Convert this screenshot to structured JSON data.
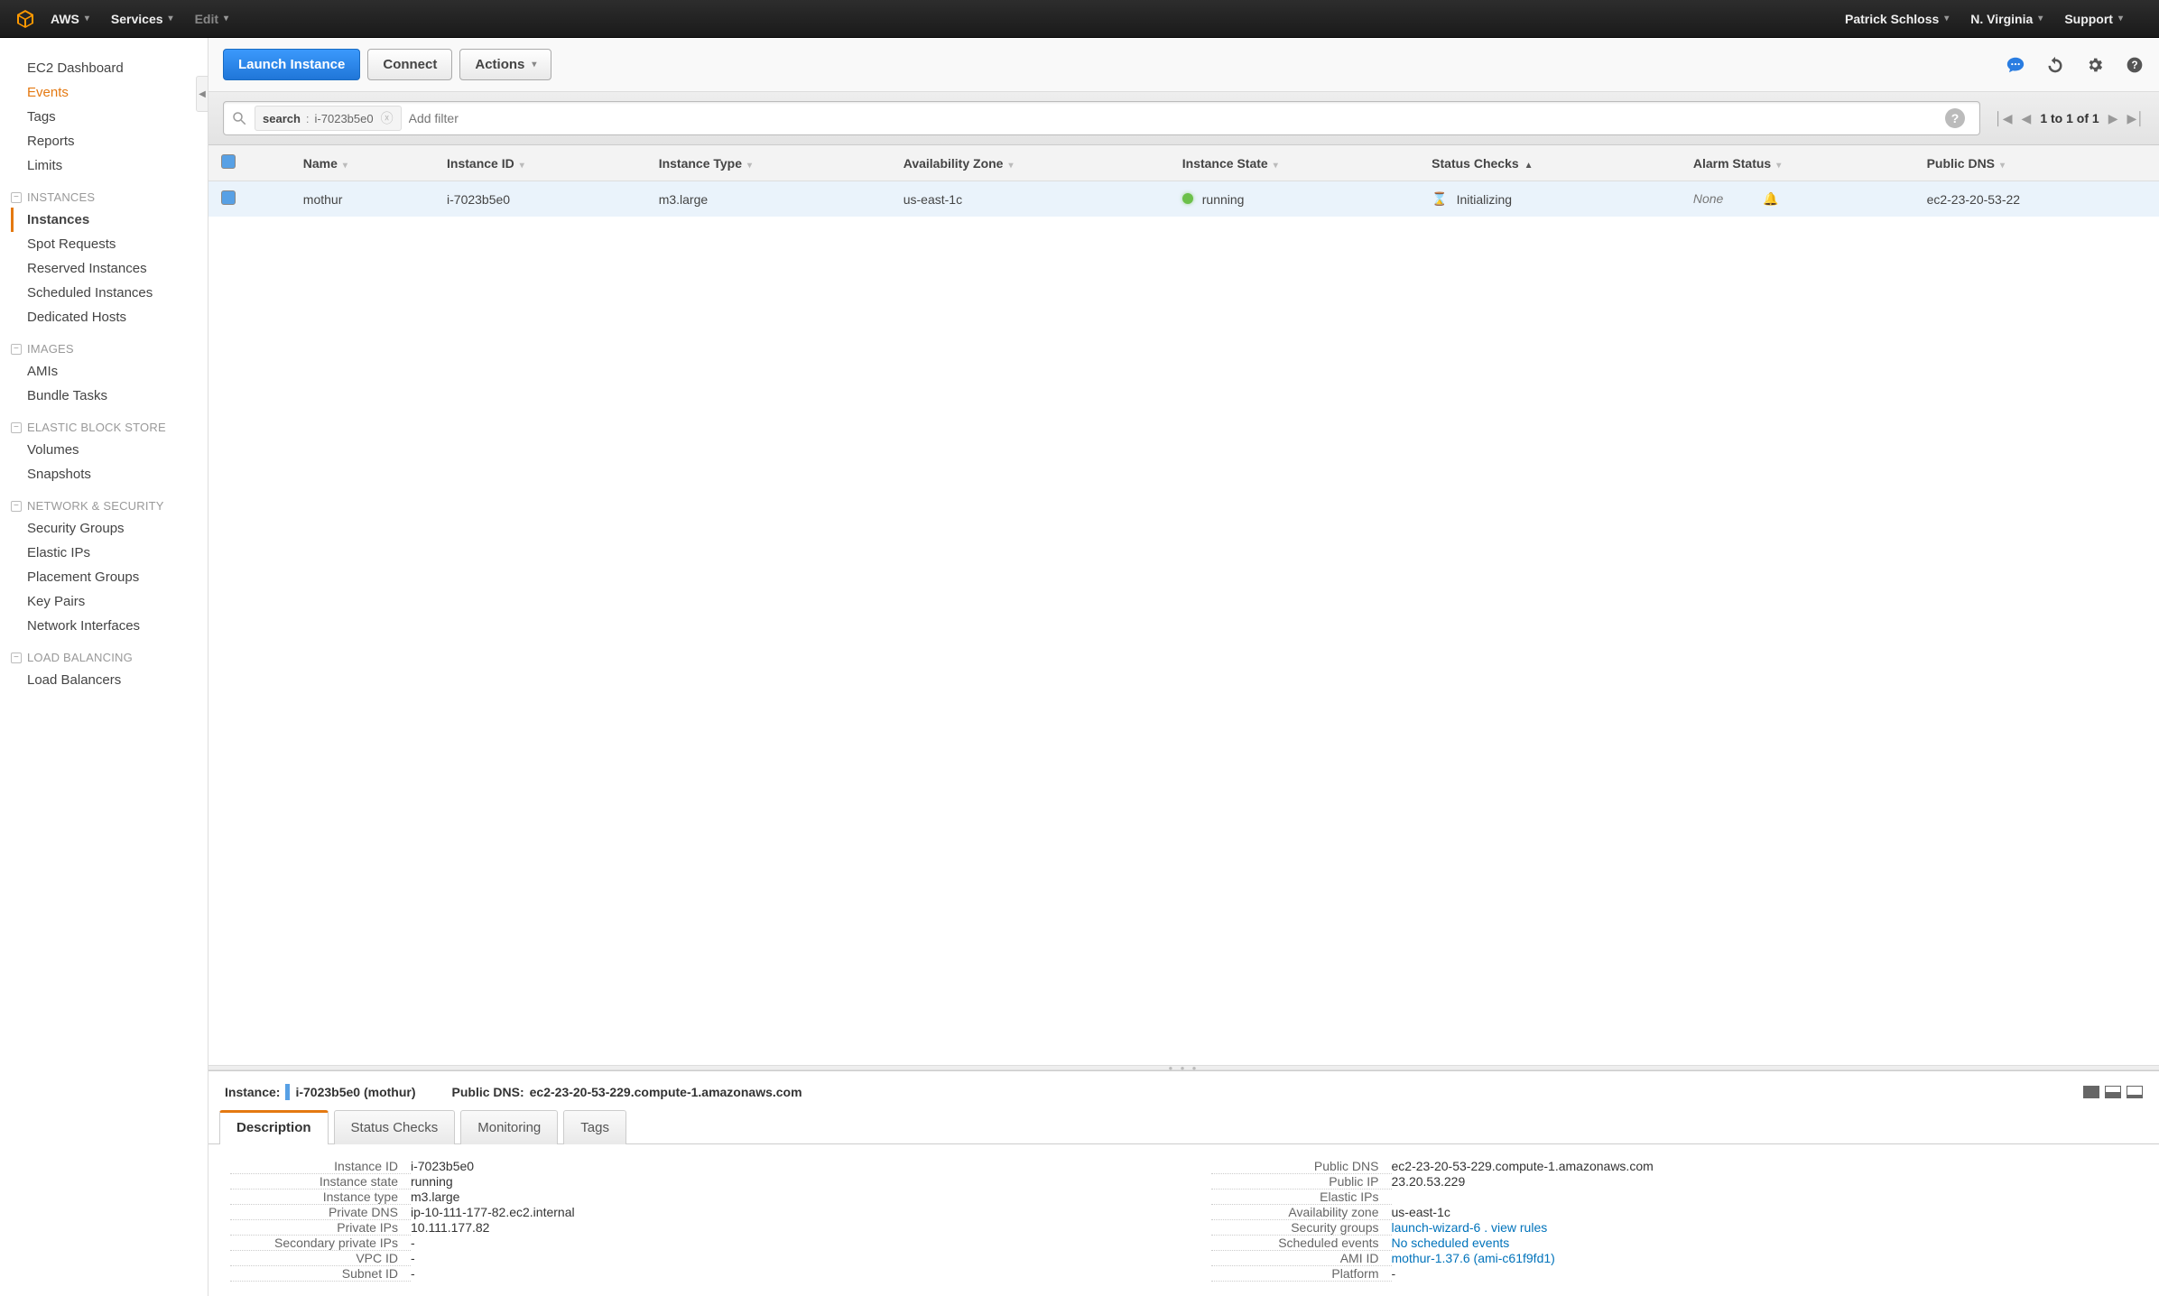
{
  "topbar": {
    "brand": "AWS",
    "services": "Services",
    "edit": "Edit",
    "user": "Patrick Schloss",
    "region": "N. Virginia",
    "support": "Support"
  },
  "sidebar": {
    "main": [
      "EC2 Dashboard",
      "Events",
      "Tags",
      "Reports",
      "Limits"
    ],
    "main_active": "Events",
    "sections": [
      {
        "title": "INSTANCES",
        "items": [
          "Instances",
          "Spot Requests",
          "Reserved Instances",
          "Scheduled Instances",
          "Dedicated Hosts"
        ],
        "bold": "Instances"
      },
      {
        "title": "IMAGES",
        "items": [
          "AMIs",
          "Bundle Tasks"
        ]
      },
      {
        "title": "ELASTIC BLOCK STORE",
        "items": [
          "Volumes",
          "Snapshots"
        ]
      },
      {
        "title": "NETWORK & SECURITY",
        "items": [
          "Security Groups",
          "Elastic IPs",
          "Placement Groups",
          "Key Pairs",
          "Network Interfaces"
        ]
      },
      {
        "title": "LOAD BALANCING",
        "items": [
          "Load Balancers"
        ]
      }
    ]
  },
  "actions": {
    "launch": "Launch Instance",
    "connect": "Connect",
    "actions": "Actions"
  },
  "filter": {
    "tag_key": "search",
    "tag_val": "i-7023b5e0",
    "placeholder": "Add filter",
    "pager": "1 to 1 of 1"
  },
  "columns": [
    "Name",
    "Instance ID",
    "Instance Type",
    "Availability Zone",
    "Instance State",
    "Status Checks",
    "Alarm Status",
    "Public DNS"
  ],
  "sort_col": "Status Checks",
  "rows": [
    {
      "name": "mothur",
      "instance_id": "i-7023b5e0",
      "instance_type": "m3.large",
      "az": "us-east-1c",
      "state": "running",
      "status": "Initializing",
      "alarm": "None",
      "public_dns": "ec2-23-20-53-22"
    }
  ],
  "detail": {
    "header_instance_label": "Instance:",
    "header_instance_value": "i-7023b5e0 (mothur)",
    "header_dns_label": "Public DNS:",
    "header_dns_value": "ec2-23-20-53-229.compute-1.amazonaws.com",
    "tabs": [
      "Description",
      "Status Checks",
      "Monitoring",
      "Tags"
    ],
    "active_tab": "Description",
    "left": [
      {
        "k": "Instance ID",
        "v": "i-7023b5e0"
      },
      {
        "k": "Instance state",
        "v": "running"
      },
      {
        "k": "Instance type",
        "v": "m3.large"
      },
      {
        "k": "Private DNS",
        "v": "ip-10-111-177-82.ec2.internal"
      },
      {
        "k": "Private IPs",
        "v": "10.111.177.82"
      },
      {
        "k": "Secondary private IPs",
        "v": "-"
      },
      {
        "k": "VPC ID",
        "v": "-"
      },
      {
        "k": "Subnet ID",
        "v": "-"
      }
    ],
    "right": [
      {
        "k": "Public DNS",
        "v": "ec2-23-20-53-229.compute-1.amazonaws.com"
      },
      {
        "k": "Public IP",
        "v": "23.20.53.229"
      },
      {
        "k": "Elastic IPs",
        "v": ""
      },
      {
        "k": "Availability zone",
        "v": "us-east-1c"
      },
      {
        "k": "Security groups",
        "v": "launch-wizard-6 . view rules",
        "link": true
      },
      {
        "k": "Scheduled events",
        "v": "No scheduled events",
        "link": true
      },
      {
        "k": "AMI ID",
        "v": "mothur-1.37.6 (ami-c61f9fd1)",
        "link": true
      },
      {
        "k": "Platform",
        "v": "-"
      }
    ]
  }
}
